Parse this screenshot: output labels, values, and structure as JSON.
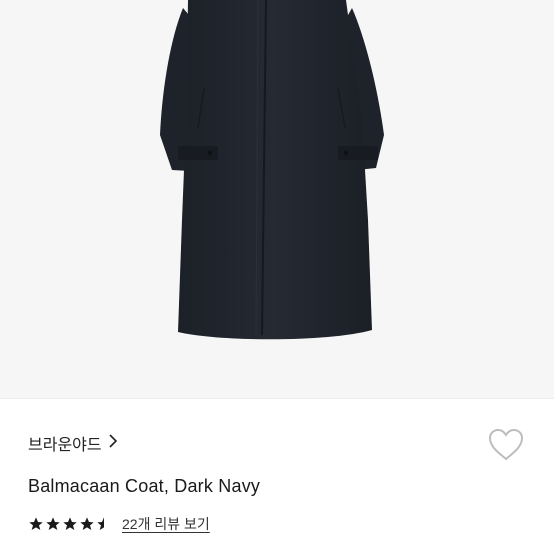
{
  "product": {
    "brand": "브라운야드",
    "title": "Balmacaan Coat, Dark Navy",
    "rating": 4.5,
    "review_link_text": "22개 리뷰 보기"
  },
  "colors": {
    "image_bg": "#f6f6f6",
    "coat": "#1f232b",
    "star": "#1a1a1a",
    "heart_outline": "#bdbdbd"
  },
  "icons": {
    "brand_chevron": "chevron-right-icon",
    "wishlist": "heart-icon",
    "rating": "star-icon"
  }
}
